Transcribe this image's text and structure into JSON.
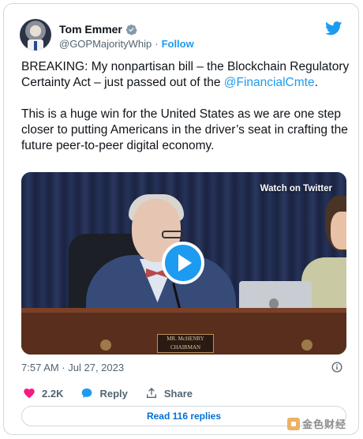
{
  "author": {
    "name": "Tom Emmer",
    "handle": "@GOPMajorityWhip",
    "separator": "·",
    "follow_label": "Follow"
  },
  "tweet": {
    "paragraph1": "BREAKING: My nonpartisan bill – the Blockchain Regulatory Certainty Act – just passed out of the",
    "mention": "@FinancialCmte",
    "mention_suffix": ".",
    "paragraph2": "This is a huge win for the United States as we are one step closer to putting Americans in the driver’s seat in crafting the future peer-to-peer digital economy."
  },
  "video": {
    "watch_label": "Watch on Twitter",
    "nameplate_name": "MR. McHENRY",
    "nameplate_title": "CHAIRMAN"
  },
  "meta": {
    "timestamp": "7:57 AM · Jul 27, 2023"
  },
  "actions": {
    "likes": "2.2K",
    "reply_label": "Reply",
    "share_label": "Share"
  },
  "replies": {
    "label": "Read 116 replies"
  },
  "watermark": {
    "text": "金色财经"
  },
  "colors": {
    "accent": "#1d9bf0",
    "like": "#f91880",
    "link": "#006fd6",
    "muted": "#536471"
  },
  "icons": [
    "verified-badge-icon",
    "twitter-bird-icon",
    "play-icon",
    "info-icon",
    "heart-icon",
    "reply-bubble-icon",
    "share-icon"
  ]
}
